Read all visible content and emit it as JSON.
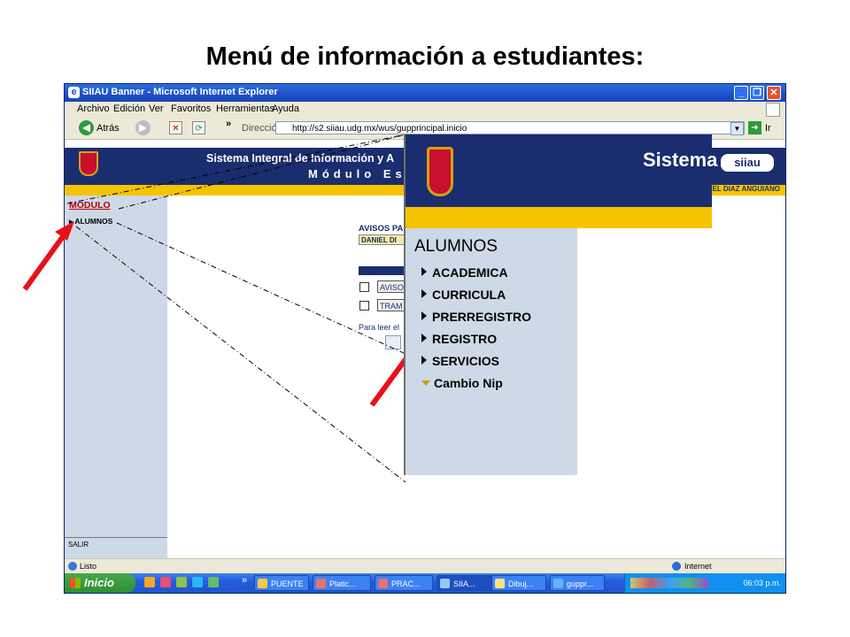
{
  "slide": {
    "title": "Menú de información a estudiantes:"
  },
  "browser": {
    "window_title": "SIIAU Banner - Microsoft Internet Explorer",
    "menu": [
      "Archivo",
      "Edición",
      "Ver",
      "Favoritos",
      "Herramientas",
      "Ayuda"
    ],
    "back_label": "Atrás",
    "address_label": "Dirección",
    "address_url": "http://s2.siiau.udg.mx/wus/gupprincipal.inicio",
    "go_label": "Ir",
    "status_left": "Listo",
    "status_zone": "Internet"
  },
  "page": {
    "header_line1": "Sistema Integral de Información y A",
    "header_line2": "Módulo Es",
    "user_name": "EL DIAZ ANGUIANO",
    "nav_title": "MODULO",
    "nav_item": "ALUMNOS",
    "nav_exit": "SALIR",
    "avisos_title": "AVISOS PA",
    "student_name": "DANIEL DI",
    "row1": "AVISO",
    "row2": "TRAM",
    "read_note": "Para leer el"
  },
  "zoom": {
    "header_text": "Sistema",
    "logo_text": "siiau",
    "heading": "ALUMNOS",
    "items": [
      "ACADEMICA",
      "CURRICULA",
      "PRERREGISTRO",
      "REGISTRO",
      "SERVICIOS"
    ],
    "expanded_item": "Cambio Nip"
  },
  "taskbar": {
    "start_label": "Inicio",
    "tasks": [
      "PUENTE",
      "Platic...",
      "PRAC...",
      "SIIA...",
      "Dibuj...",
      "guppr..."
    ],
    "clock": "06:03 p.m."
  },
  "colors": {
    "banner": "#1a2d6e",
    "yellow": "#f5c400",
    "nav": "#cdd9e6",
    "arrow": "#e8101a"
  }
}
